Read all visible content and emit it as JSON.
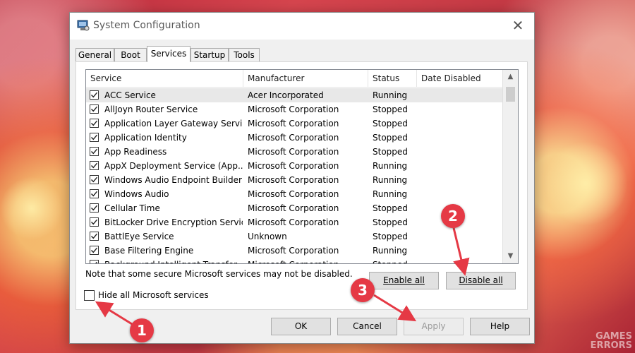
{
  "window": {
    "title": "System Configuration",
    "close_glyph": "✕"
  },
  "tabs": [
    {
      "label": "General"
    },
    {
      "label": "Boot"
    },
    {
      "label": "Services",
      "active": true
    },
    {
      "label": "Startup"
    },
    {
      "label": "Tools"
    }
  ],
  "table": {
    "columns": [
      "Service",
      "Manufacturer",
      "Status",
      "Date Disabled"
    ],
    "rows": [
      {
        "service": "ACC Service",
        "manufacturer": "Acer Incorporated",
        "status": "Running",
        "checked": true
      },
      {
        "service": "AllJoyn Router Service",
        "manufacturer": "Microsoft Corporation",
        "status": "Stopped",
        "checked": true
      },
      {
        "service": "Application Layer Gateway Service",
        "manufacturer": "Microsoft Corporation",
        "status": "Stopped",
        "checked": true
      },
      {
        "service": "Application Identity",
        "manufacturer": "Microsoft Corporation",
        "status": "Stopped",
        "checked": true
      },
      {
        "service": "App Readiness",
        "manufacturer": "Microsoft Corporation",
        "status": "Stopped",
        "checked": true
      },
      {
        "service": "AppX Deployment Service (App...",
        "manufacturer": "Microsoft Corporation",
        "status": "Running",
        "checked": true
      },
      {
        "service": "Windows Audio Endpoint Builder",
        "manufacturer": "Microsoft Corporation",
        "status": "Running",
        "checked": true
      },
      {
        "service": "Windows Audio",
        "manufacturer": "Microsoft Corporation",
        "status": "Running",
        "checked": true
      },
      {
        "service": "Cellular Time",
        "manufacturer": "Microsoft Corporation",
        "status": "Stopped",
        "checked": true
      },
      {
        "service": "BitLocker Drive Encryption Service",
        "manufacturer": "Microsoft Corporation",
        "status": "Stopped",
        "checked": true
      },
      {
        "service": "BattlEye Service",
        "manufacturer": "Unknown",
        "status": "Stopped",
        "checked": true
      },
      {
        "service": "Base Filtering Engine",
        "manufacturer": "Microsoft Corporation",
        "status": "Running",
        "checked": true
      },
      {
        "service": "Background Intelligent Transfer...",
        "manufacturer": "Microsoft Corporation",
        "status": "Stopped",
        "checked": true
      }
    ]
  },
  "note": "Note that some secure Microsoft services may not be disabled.",
  "buttons": {
    "enable_all": "Enable all",
    "disable_all": "Disable all",
    "ok": "OK",
    "cancel": "Cancel",
    "apply": "Apply",
    "help": "Help"
  },
  "hide_ms": {
    "label": "Hide all Microsoft services",
    "checked": false
  },
  "callouts": [
    "1",
    "2",
    "3"
  ],
  "watermark": [
    "GAMES",
    "ERRORS"
  ],
  "colors": {
    "callout": "#e53945",
    "window_bg": "#f0f0f0",
    "selected_row": "#e8e8e8"
  }
}
